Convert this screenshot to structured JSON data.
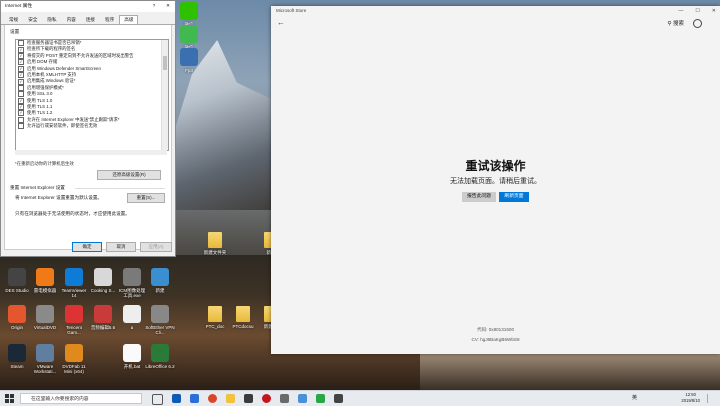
{
  "ie": {
    "title": "Internet 属性",
    "help": "?",
    "close": "✕",
    "tabs": [
      "常规",
      "安全",
      "隐私",
      "内容",
      "连接",
      "程序",
      "高级"
    ],
    "settings_label": "设置",
    "rows": [
      {
        "label": "检查服务器证书是否已吊销*",
        "checked": false
      },
      {
        "label": "检查所下载的程序的签名",
        "checked": true
      },
      {
        "label": "将提交的 POST 重定向到不允许发送的区域时发出警告",
        "checked": true
      },
      {
        "label": "启用 DOM 存储",
        "checked": true
      },
      {
        "label": "启用 Windows Defender SmartScreen",
        "checked": true
      },
      {
        "label": "启用本机 XMLHTTP 支持",
        "checked": true
      },
      {
        "label": "启用集成 Windows 验证*",
        "checked": true
      },
      {
        "label": "启用增强保护模式*",
        "checked": false
      },
      {
        "label": "使用 SSL 3.0",
        "checked": false
      },
      {
        "label": "使用 TLS 1.0",
        "checked": true
      },
      {
        "label": "使用 TLS 1.1",
        "checked": true
      },
      {
        "label": "使用 TLS 1.2",
        "checked": true
      },
      {
        "label": "允许在 Internet Explorer 中发送\"禁止跟踪\"请求*",
        "checked": false
      },
      {
        "label": "允许运行或安装软件，即使签名无效",
        "checked": false
      }
    ],
    "restart_note": "*在重新启动你的计算机后生效",
    "restore_button": "还原高级设置(R)",
    "reset_heading": "重置 Internet Explorer 设置",
    "reset_desc": "将 Internet Explorer 设置重置为默认设置。",
    "reset_button": "重置(S)...",
    "reset_note": "只有在浏览器处于无法使用的状态时，才应使用此设置。",
    "ok": "确定",
    "cancel": "取消",
    "apply": "应用(A)"
  },
  "store": {
    "title": "Microsoft Store",
    "min": "—",
    "max": "☐",
    "close": "✕",
    "back": "←",
    "search": "搜索",
    "error_title": "重试该操作",
    "error_sub": "无法加载页面。请稍后重试。",
    "report_button": "报告此问题",
    "refresh_button": "刷新页面",
    "code": "代码: 0x80131500",
    "cv": "CV: hgJ6BaKgB6WbS8"
  },
  "desktop": {
    "icons": [
      {
        "label": "DES Studio"
      },
      {
        "label": "雷电模拟器"
      },
      {
        "label": "TeamViewer 14"
      },
      {
        "label": "Cooking S..."
      },
      {
        "label": "ICM图像处理工具.exe"
      },
      {
        "label": "新建"
      },
      {
        "label": "Origin"
      },
      {
        "label": "VirtualDVD"
      },
      {
        "label": "Tencent Gam..."
      },
      {
        "label": "音频编辑5.6"
      },
      {
        "label": "a"
      },
      {
        "label": "SoftEther VPN Cli..."
      },
      {
        "label": "Steam"
      },
      {
        "label": "VMware Workstati..."
      },
      {
        "label": "DVDFab 11 Mini (x64)"
      },
      {
        "label": "开机.bat"
      },
      {
        "label": "LibreOffice 6.2"
      }
    ],
    "folders": [
      {
        "label": "新建文件夹"
      },
      {
        "label": "新建"
      },
      {
        "label": "PTC_doc"
      },
      {
        "label": "PTCdocsu"
      },
      {
        "label": "新建(2)"
      }
    ],
    "top_icons": [
      {
        "label": "微信"
      },
      {
        "label": "微信"
      },
      {
        "label": "Fp3"
      }
    ]
  },
  "taskbar": {
    "search_placeholder": "在这里输入你要搜索的内容",
    "time": "12:50",
    "date": "2019/8/10",
    "lang": "英"
  }
}
